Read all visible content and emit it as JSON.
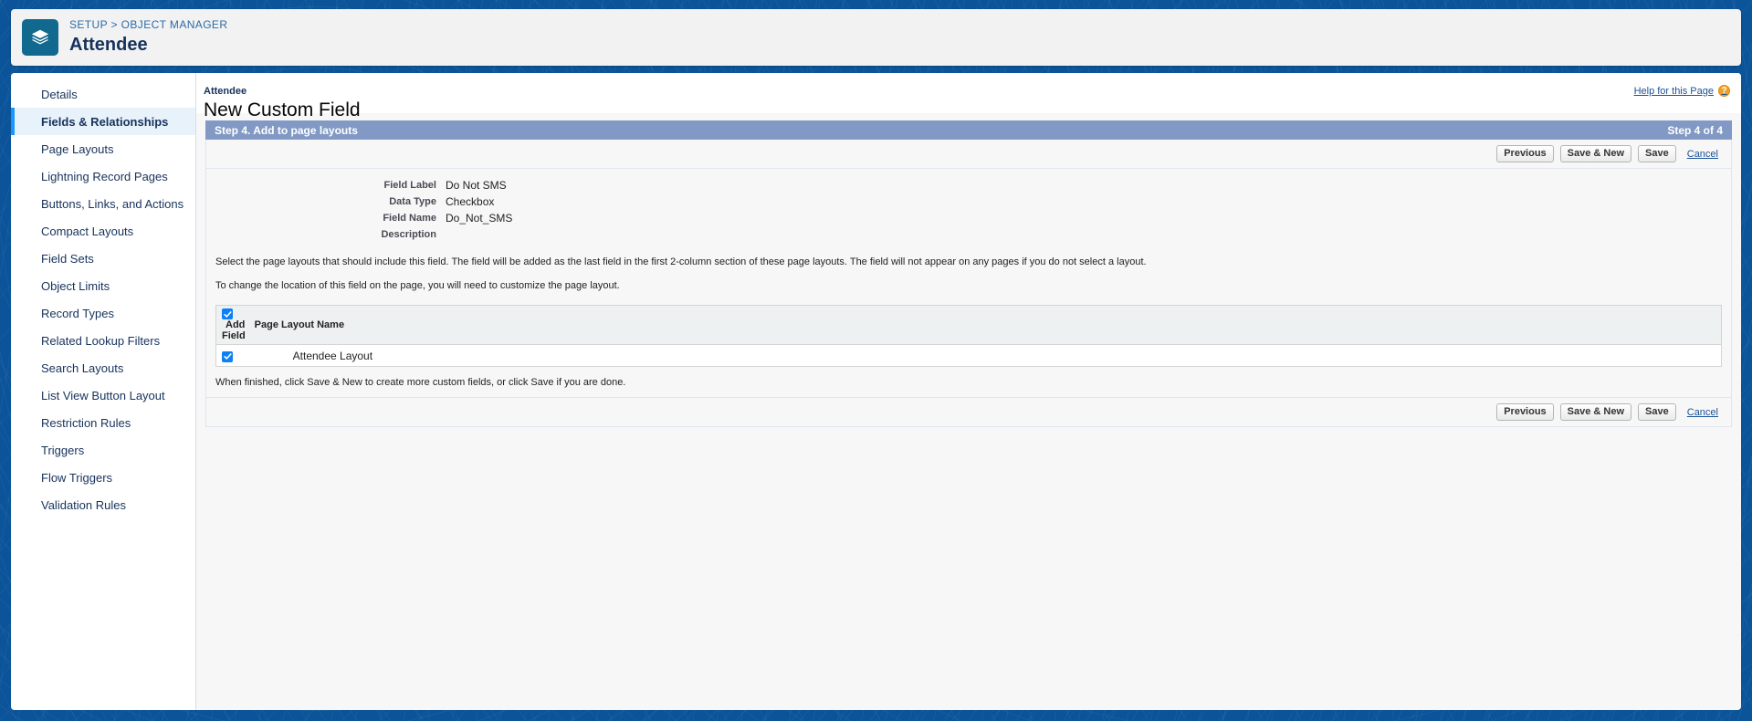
{
  "header": {
    "app_icon": "layers-icon",
    "breadcrumb": "SETUP > OBJECT MANAGER",
    "object_title": "Attendee"
  },
  "sidebar": {
    "items": [
      {
        "label": "Details",
        "selected": false
      },
      {
        "label": "Fields & Relationships",
        "selected": true
      },
      {
        "label": "Page Layouts",
        "selected": false
      },
      {
        "label": "Lightning Record Pages",
        "selected": false
      },
      {
        "label": "Buttons, Links, and Actions",
        "selected": false
      },
      {
        "label": "Compact Layouts",
        "selected": false
      },
      {
        "label": "Field Sets",
        "selected": false
      },
      {
        "label": "Object Limits",
        "selected": false
      },
      {
        "label": "Record Types",
        "selected": false
      },
      {
        "label": "Related Lookup Filters",
        "selected": false
      },
      {
        "label": "Search Layouts",
        "selected": false
      },
      {
        "label": "List View Button Layout",
        "selected": false
      },
      {
        "label": "Restriction Rules",
        "selected": false
      },
      {
        "label": "Triggers",
        "selected": false
      },
      {
        "label": "Flow Triggers",
        "selected": false
      },
      {
        "label": "Validation Rules",
        "selected": false
      }
    ]
  },
  "page": {
    "eyebrow": "Attendee",
    "title": "New Custom Field",
    "help_link": "Help for this Page",
    "help_icon_glyph": "?"
  },
  "wizard": {
    "step_title": "Step 4. Add to page layouts",
    "step_counter": "Step 4 of 4",
    "buttons": {
      "previous": "Previous",
      "save_and_new": "Save & New",
      "save": "Save",
      "cancel": "Cancel"
    },
    "field_summary": [
      {
        "label": "Field Label",
        "value": "Do Not SMS"
      },
      {
        "label": "Data Type",
        "value": "Checkbox"
      },
      {
        "label": "Field Name",
        "value": "Do_Not_SMS"
      },
      {
        "label": "Description",
        "value": ""
      }
    ],
    "instructions": [
      "Select the page layouts that should include this field. The field will be added as the last field in the first 2-column section of these page layouts. The field will not appear on any pages if you do not select a layout.",
      "To change the location of this field on the page, you will need to customize the page layout."
    ],
    "table": {
      "headers": {
        "add_field": "Add Field",
        "page_layout_name": "Page Layout Name"
      },
      "header_checkbox_checked": true,
      "rows": [
        {
          "checked": true,
          "page_layout_name": "Attendee Layout"
        }
      ]
    },
    "finished_note": "When finished, click Save & New to create more custom fields, or click Save if you are done."
  },
  "colors": {
    "background_blue": "#0b5499",
    "step_bar": "#8199c4",
    "selected_nav_bg": "#e8f2fb",
    "accent_blue": "#1b96ff",
    "link_blue": "#1b5297",
    "checkbox_blue": "#0d7ff7",
    "help_icon_orange": "#f2a024",
    "app_icon_bg": "#11698f"
  }
}
